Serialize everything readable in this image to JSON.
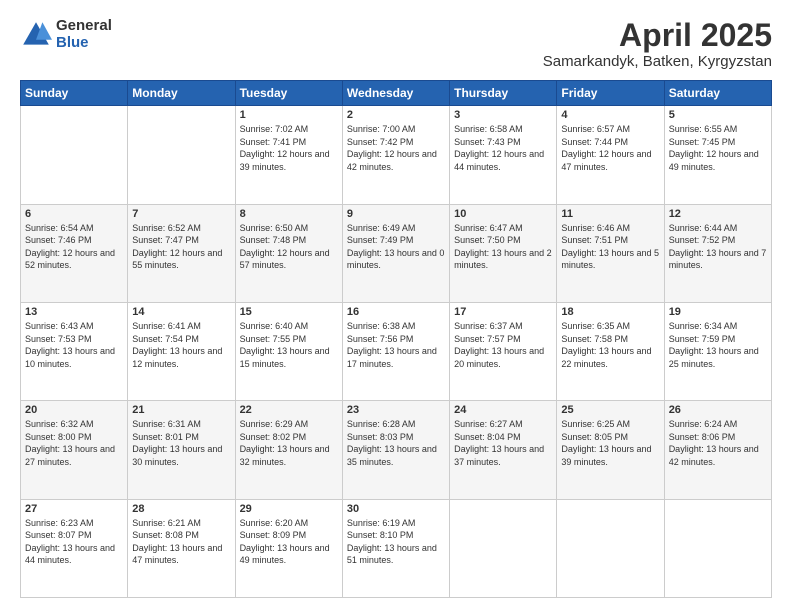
{
  "header": {
    "logo_general": "General",
    "logo_blue": "Blue",
    "title": "April 2025",
    "subtitle": "Samarkandyk, Batken, Kyrgyzstan"
  },
  "days_of_week": [
    "Sunday",
    "Monday",
    "Tuesday",
    "Wednesday",
    "Thursday",
    "Friday",
    "Saturday"
  ],
  "weeks": [
    [
      {
        "day": "",
        "info": ""
      },
      {
        "day": "",
        "info": ""
      },
      {
        "day": "1",
        "info": "Sunrise: 7:02 AM\nSunset: 7:41 PM\nDaylight: 12 hours and 39 minutes."
      },
      {
        "day": "2",
        "info": "Sunrise: 7:00 AM\nSunset: 7:42 PM\nDaylight: 12 hours and 42 minutes."
      },
      {
        "day": "3",
        "info": "Sunrise: 6:58 AM\nSunset: 7:43 PM\nDaylight: 12 hours and 44 minutes."
      },
      {
        "day": "4",
        "info": "Sunrise: 6:57 AM\nSunset: 7:44 PM\nDaylight: 12 hours and 47 minutes."
      },
      {
        "day": "5",
        "info": "Sunrise: 6:55 AM\nSunset: 7:45 PM\nDaylight: 12 hours and 49 minutes."
      }
    ],
    [
      {
        "day": "6",
        "info": "Sunrise: 6:54 AM\nSunset: 7:46 PM\nDaylight: 12 hours and 52 minutes."
      },
      {
        "day": "7",
        "info": "Sunrise: 6:52 AM\nSunset: 7:47 PM\nDaylight: 12 hours and 55 minutes."
      },
      {
        "day": "8",
        "info": "Sunrise: 6:50 AM\nSunset: 7:48 PM\nDaylight: 12 hours and 57 minutes."
      },
      {
        "day": "9",
        "info": "Sunrise: 6:49 AM\nSunset: 7:49 PM\nDaylight: 13 hours and 0 minutes."
      },
      {
        "day": "10",
        "info": "Sunrise: 6:47 AM\nSunset: 7:50 PM\nDaylight: 13 hours and 2 minutes."
      },
      {
        "day": "11",
        "info": "Sunrise: 6:46 AM\nSunset: 7:51 PM\nDaylight: 13 hours and 5 minutes."
      },
      {
        "day": "12",
        "info": "Sunrise: 6:44 AM\nSunset: 7:52 PM\nDaylight: 13 hours and 7 minutes."
      }
    ],
    [
      {
        "day": "13",
        "info": "Sunrise: 6:43 AM\nSunset: 7:53 PM\nDaylight: 13 hours and 10 minutes."
      },
      {
        "day": "14",
        "info": "Sunrise: 6:41 AM\nSunset: 7:54 PM\nDaylight: 13 hours and 12 minutes."
      },
      {
        "day": "15",
        "info": "Sunrise: 6:40 AM\nSunset: 7:55 PM\nDaylight: 13 hours and 15 minutes."
      },
      {
        "day": "16",
        "info": "Sunrise: 6:38 AM\nSunset: 7:56 PM\nDaylight: 13 hours and 17 minutes."
      },
      {
        "day": "17",
        "info": "Sunrise: 6:37 AM\nSunset: 7:57 PM\nDaylight: 13 hours and 20 minutes."
      },
      {
        "day": "18",
        "info": "Sunrise: 6:35 AM\nSunset: 7:58 PM\nDaylight: 13 hours and 22 minutes."
      },
      {
        "day": "19",
        "info": "Sunrise: 6:34 AM\nSunset: 7:59 PM\nDaylight: 13 hours and 25 minutes."
      }
    ],
    [
      {
        "day": "20",
        "info": "Sunrise: 6:32 AM\nSunset: 8:00 PM\nDaylight: 13 hours and 27 minutes."
      },
      {
        "day": "21",
        "info": "Sunrise: 6:31 AM\nSunset: 8:01 PM\nDaylight: 13 hours and 30 minutes."
      },
      {
        "day": "22",
        "info": "Sunrise: 6:29 AM\nSunset: 8:02 PM\nDaylight: 13 hours and 32 minutes."
      },
      {
        "day": "23",
        "info": "Sunrise: 6:28 AM\nSunset: 8:03 PM\nDaylight: 13 hours and 35 minutes."
      },
      {
        "day": "24",
        "info": "Sunrise: 6:27 AM\nSunset: 8:04 PM\nDaylight: 13 hours and 37 minutes."
      },
      {
        "day": "25",
        "info": "Sunrise: 6:25 AM\nSunset: 8:05 PM\nDaylight: 13 hours and 39 minutes."
      },
      {
        "day": "26",
        "info": "Sunrise: 6:24 AM\nSunset: 8:06 PM\nDaylight: 13 hours and 42 minutes."
      }
    ],
    [
      {
        "day": "27",
        "info": "Sunrise: 6:23 AM\nSunset: 8:07 PM\nDaylight: 13 hours and 44 minutes."
      },
      {
        "day": "28",
        "info": "Sunrise: 6:21 AM\nSunset: 8:08 PM\nDaylight: 13 hours and 47 minutes."
      },
      {
        "day": "29",
        "info": "Sunrise: 6:20 AM\nSunset: 8:09 PM\nDaylight: 13 hours and 49 minutes."
      },
      {
        "day": "30",
        "info": "Sunrise: 6:19 AM\nSunset: 8:10 PM\nDaylight: 13 hours and 51 minutes."
      },
      {
        "day": "",
        "info": ""
      },
      {
        "day": "",
        "info": ""
      },
      {
        "day": "",
        "info": ""
      }
    ]
  ]
}
